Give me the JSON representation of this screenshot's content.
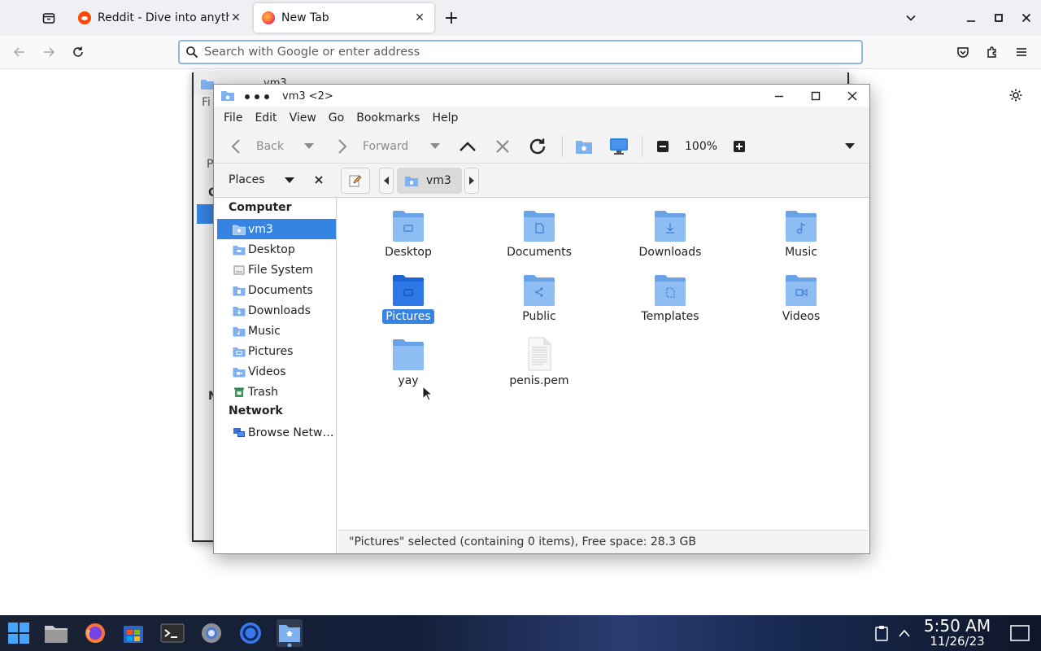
{
  "browser": {
    "tabs": [
      {
        "label": "Reddit - Dive into anything",
        "favicon": "reddit-icon"
      },
      {
        "label": "New Tab",
        "favicon": "firefox-icon",
        "active": true
      }
    ],
    "urlbar_placeholder": "Search with Google or enter address"
  },
  "bg_window": {
    "title": "vm3",
    "fragments": [
      "Fi",
      "P",
      "C",
      "N"
    ]
  },
  "file_manager": {
    "title": "vm3 <2>",
    "menu": [
      "File",
      "Edit",
      "View",
      "Go",
      "Bookmarks",
      "Help"
    ],
    "toolbar": {
      "back": "Back",
      "forward": "Forward",
      "zoom": "100%"
    },
    "places_label": "Places",
    "breadcrumb": "vm3",
    "sidebar": {
      "computer_header": "Computer",
      "network_header": "Network",
      "items": [
        {
          "label": "vm3",
          "icon": "home-folder-icon",
          "selected": true
        },
        {
          "label": "Desktop",
          "icon": "folder-icon"
        },
        {
          "label": "File System",
          "icon": "drive-icon"
        },
        {
          "label": "Documents",
          "icon": "folder-icon"
        },
        {
          "label": "Downloads",
          "icon": "folder-icon"
        },
        {
          "label": "Music",
          "icon": "folder-icon"
        },
        {
          "label": "Pictures",
          "icon": "folder-icon"
        },
        {
          "label": "Videos",
          "icon": "folder-icon"
        },
        {
          "label": "Trash",
          "icon": "trash-icon"
        }
      ],
      "network_items": [
        {
          "label": "Browse Netw…",
          "icon": "network-icon"
        }
      ]
    },
    "files": [
      {
        "name": "Desktop",
        "icon": "desktop-folder-icon"
      },
      {
        "name": "Documents",
        "icon": "documents-folder-icon"
      },
      {
        "name": "Downloads",
        "icon": "downloads-folder-icon"
      },
      {
        "name": "Music",
        "icon": "music-folder-icon"
      },
      {
        "name": "Pictures",
        "icon": "pictures-folder-icon",
        "selected": true
      },
      {
        "name": "Public",
        "icon": "public-folder-icon"
      },
      {
        "name": "Templates",
        "icon": "templates-folder-icon"
      },
      {
        "name": "Videos",
        "icon": "videos-folder-icon"
      },
      {
        "name": "yay",
        "icon": "folder-icon"
      },
      {
        "name": "penis.pem",
        "icon": "text-file-icon"
      }
    ],
    "status": "\"Pictures\" selected (containing 0 items), Free space: 28.3 GB"
  },
  "taskbar": {
    "time": "5:50 AM",
    "date": "11/26/23",
    "apps": [
      "start-menu-icon",
      "files-icon",
      "firefox-icon",
      "store-icon",
      "terminal-icon",
      "settings-icon",
      "browser-icon",
      "file-manager-icon"
    ]
  },
  "colors": {
    "accent": "#3584e4",
    "folder": "#7fb1ee",
    "folder_dark": "#3584e4"
  }
}
